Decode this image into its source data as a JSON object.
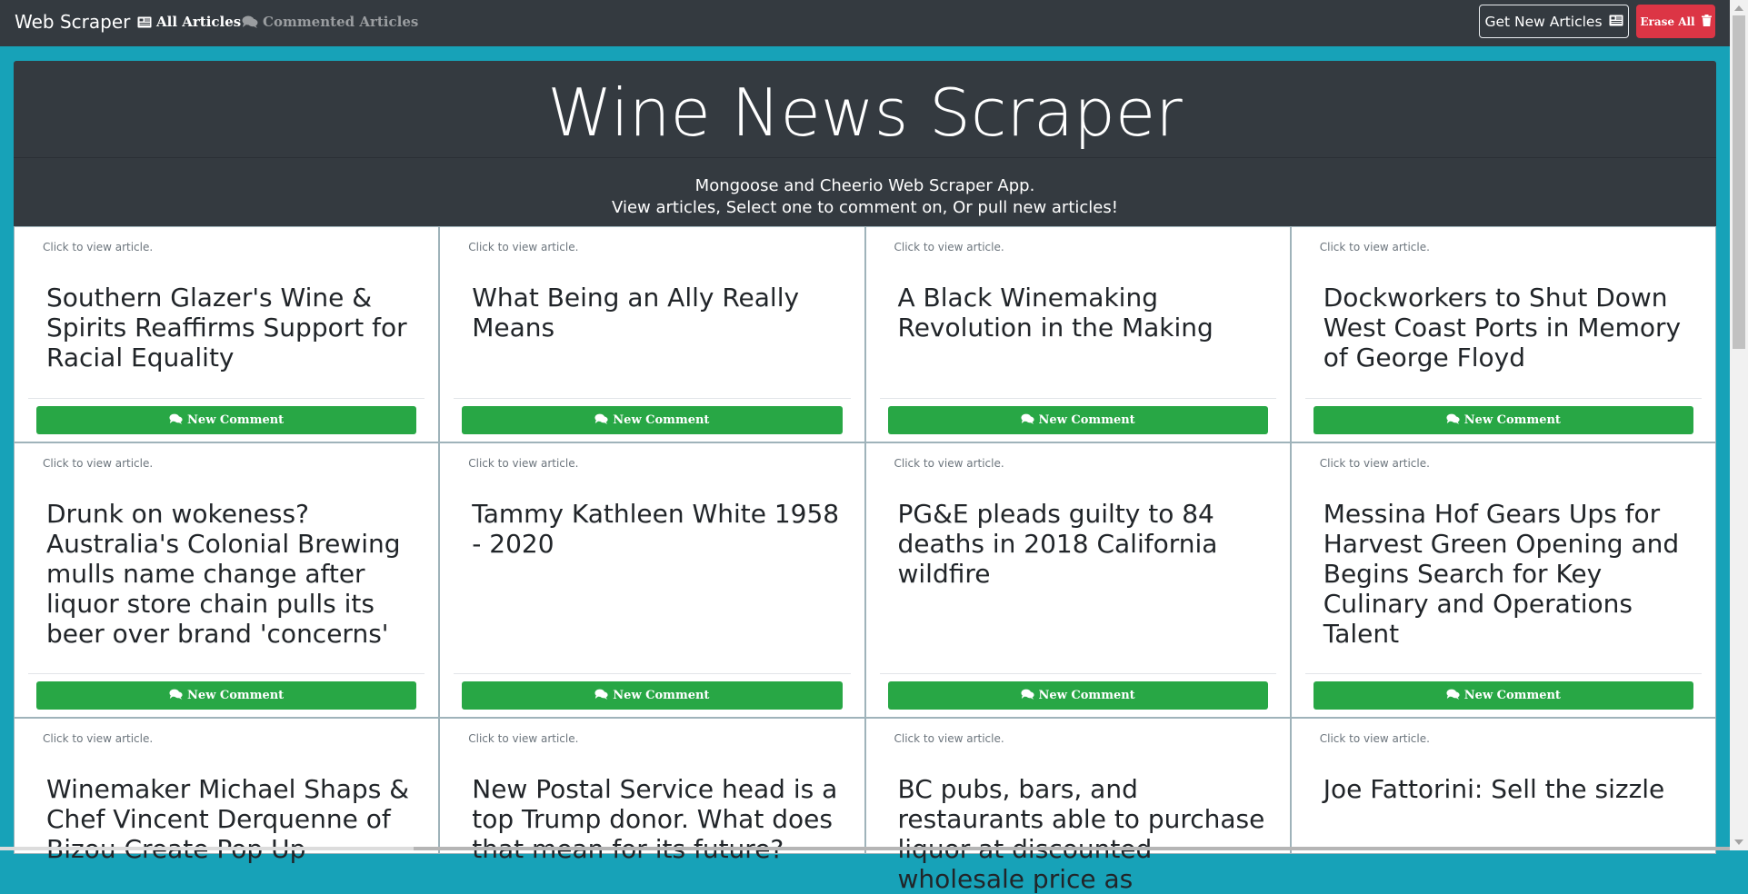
{
  "nav": {
    "brand": "Web Scraper",
    "all_articles": "All Articles",
    "commented_articles": "Commented Articles",
    "get_new_articles": "Get New Articles",
    "erase_all": "Erase All"
  },
  "jumbotron": {
    "title": "Wine News Scraper",
    "subtitle_line1": "Mongoose and Cheerio Web Scraper App.",
    "subtitle_line2": "View articles, Select one to comment on, Or pull new articles!"
  },
  "card_hint": "Click to view article.",
  "comment_label": "New Comment",
  "colors": {
    "navbar": "#343a40",
    "page_background": "#17a2b8",
    "comment_button": "#28a745",
    "erase_button": "#dc3545"
  },
  "articles": [
    {
      "title": "Southern Glazer's Wine & Spirits Reaffirms Support for Racial Equality"
    },
    {
      "title": "What Being an Ally Really Means"
    },
    {
      "title": "A Black Winemaking Revolution in the Making"
    },
    {
      "title": "Dockworkers to Shut Down West Coast Ports in Memory of George Floyd"
    },
    {
      "title": "Drunk on wokeness? Australia's Colonial Brewing mulls name change after liquor store chain pulls its beer over brand 'concerns'"
    },
    {
      "title": "Tammy Kathleen White 1958 - 2020"
    },
    {
      "title": "PG&E pleads guilty to 84 deaths in 2018 California wildfire"
    },
    {
      "title": "Messina Hof Gears Ups for Harvest Green Opening and Begins Search for Key Culinary and Operations Talent"
    },
    {
      "title": "Winemaker Michael Shaps & Chef Vincent Derquenne of Bizou Create Pop Up"
    },
    {
      "title": "New Postal Service head is a top Trump donor. What does that mean for its future?"
    },
    {
      "title": "BC pubs, bars, and restaurants able to purchase liquor at discounted wholesale price as"
    },
    {
      "title": "Joe Fattorini: Sell the sizzle"
    }
  ]
}
